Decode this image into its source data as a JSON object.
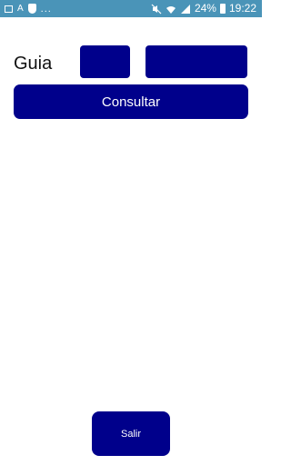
{
  "status_bar": {
    "battery_percent": "24%",
    "time": "19:22",
    "left_icons": [
      "image-icon",
      "text-a-icon",
      "shield-icon",
      "more-dots-icon"
    ],
    "dots": "...",
    "a_text": "A",
    "right_icons": [
      "mute-icon",
      "wifi-icon",
      "signal-icon",
      "battery-icon"
    ]
  },
  "form": {
    "label": "Guia",
    "field_a_value": "",
    "field_b_value": "",
    "consult_label": "Consultar"
  },
  "footer": {
    "exit_label": "Salir"
  },
  "colors": {
    "accent": "#00008b",
    "status_bar": "#4a94b8"
  }
}
